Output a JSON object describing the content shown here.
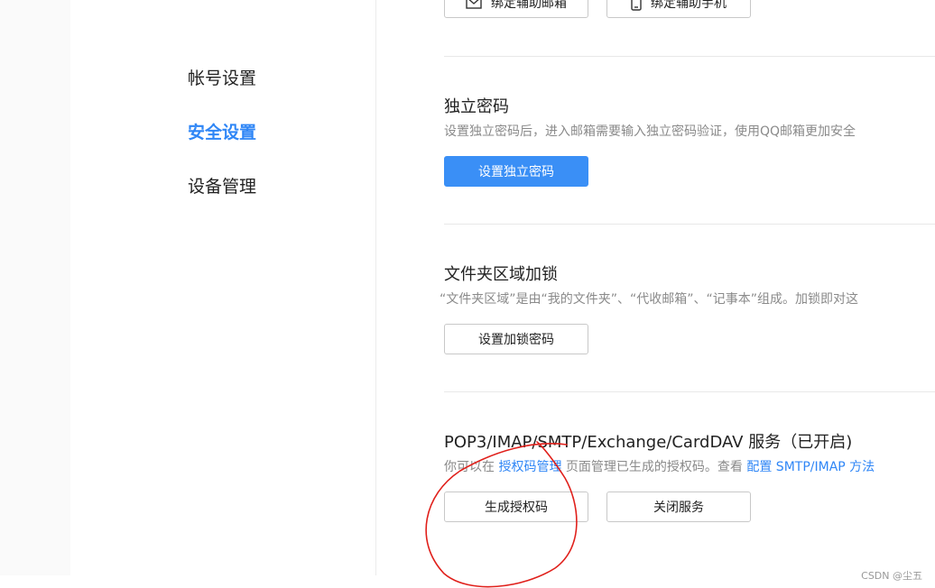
{
  "sidebar": {
    "items": [
      {
        "label": "帐号设置",
        "active": false
      },
      {
        "label": "安全设置",
        "active": true
      },
      {
        "label": "设备管理",
        "active": false
      }
    ]
  },
  "top_buttons": {
    "bind_email": "绑定辅助邮箱",
    "bind_phone": "绑定辅助手机"
  },
  "sections": {
    "independent_password": {
      "title": "独立密码",
      "desc": "设置独立密码后，进入邮箱需要输入独立密码验证，使用QQ邮箱更加安全",
      "button": "设置独立密码"
    },
    "folder_lock": {
      "title": "文件夹区域加锁",
      "desc": "“文件夹区域”是由“我的文件夹”、“代收邮箱”、“记事本”组成。加锁即对这",
      "button": "设置加锁密码"
    },
    "pop3": {
      "title": "POP3/IMAP/SMTP/Exchange/CardDAV 服务（已开启)",
      "desc_part1": "你可以在",
      "desc_link1": "授权码管理",
      "desc_part2": "页面管理已生成的授权码。查看",
      "desc_link2": "配置 SMTP/IMAP 方法",
      "button_generate": "生成授权码",
      "button_close": "关闭服务"
    }
  },
  "watermark": "CSDN @尘五",
  "colors": {
    "accent": "#2f86f6",
    "primary_button": "#3a8ff6",
    "annotation": "#e0201b"
  }
}
